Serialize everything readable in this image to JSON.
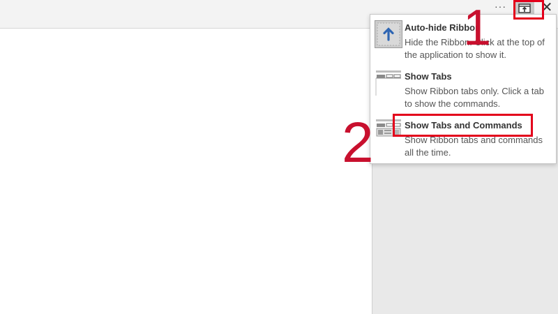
{
  "titlebar": {
    "dots": "···",
    "close_glyph": "✕"
  },
  "menu": {
    "items": [
      {
        "title": "Auto-hide Ribbon",
        "description": "Hide the Ribbon. Click at the top of the application to show it."
      },
      {
        "title": "Show Tabs",
        "description": "Show Ribbon tabs only. Click a tab to show the commands."
      },
      {
        "title": "Show Tabs and Commands",
        "description": "Show Ribbon tabs and commands all the time."
      }
    ]
  },
  "annotations": {
    "step1": "1",
    "step2": "2"
  },
  "colors": {
    "annotation_red": "#e3001b",
    "number_red": "#c8102e",
    "arrow_blue": "#2f66b3"
  },
  "icons": [
    "more-options-icon",
    "ribbon-display-options-icon",
    "close-icon",
    "auto-hide-ribbon-icon",
    "show-tabs-icon",
    "show-tabs-and-commands-icon"
  ]
}
